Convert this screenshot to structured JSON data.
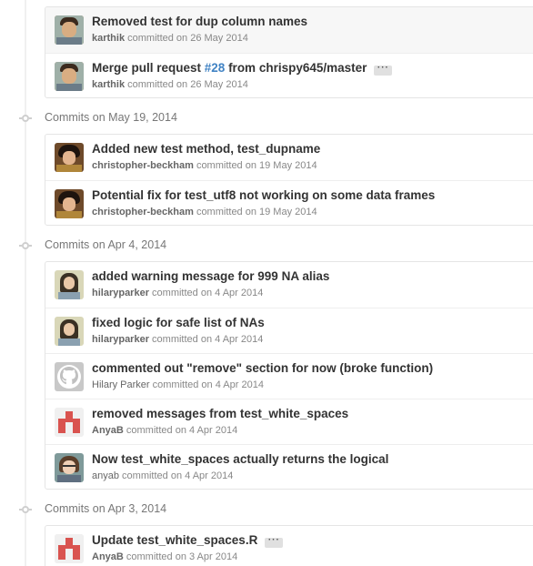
{
  "groups": [
    {
      "title": "",
      "commits": [
        {
          "title": "Removed test for dup column names",
          "author": "karthik",
          "meta": "committed on 26 May 2014",
          "avatar": "karthik-avatar"
        },
        {
          "title_prefix": "Merge pull request ",
          "pr_link": "#28",
          "title_suffix": " from chrispy645/master",
          "ellipsis": "···",
          "author": "karthik",
          "meta": "committed on 26 May 2014",
          "avatar": "karthik-avatar"
        }
      ]
    },
    {
      "title": "Commits on May 19, 2014",
      "commits": [
        {
          "title": "Added new test method, test_dupname",
          "author": "christopher-beckham",
          "meta": "committed on 19 May 2014",
          "avatar": "christopher-avatar"
        },
        {
          "title": "Potential fix for test_utf8 not working on some data frames",
          "author": "christopher-beckham",
          "meta": "committed on 19 May 2014",
          "avatar": "christopher-avatar"
        }
      ]
    },
    {
      "title": "Commits on Apr 4, 2014",
      "commits": [
        {
          "title": "added warning message for 999 NA alias",
          "author": "hilaryparker",
          "meta": "committed on 4 Apr 2014",
          "avatar": "hilary-avatar"
        },
        {
          "title": "fixed logic for safe list of NAs",
          "author": "hilaryparker",
          "meta": "committed on 4 Apr 2014",
          "avatar": "hilary-avatar"
        },
        {
          "title": "commented out \"remove\" section for now (broke function)",
          "author": "Hilary Parker",
          "meta": "committed on 4 Apr 2014",
          "avatar": "github-octocat-avatar"
        },
        {
          "title": "removed messages from test_white_spaces",
          "author": "AnyaB",
          "meta": "committed on 4 Apr 2014",
          "avatar": "identicon-avatar"
        },
        {
          "title": "Now test_white_spaces actually returns the logical",
          "author": "anyab",
          "meta": "committed on 4 Apr 2014",
          "avatar": "anya-avatar"
        }
      ]
    },
    {
      "title": "Commits on Apr 3, 2014",
      "commits": [
        {
          "title": "Update test_white_spaces.R",
          "ellipsis": "···",
          "author": "AnyaB",
          "meta": "committed on 3 Apr 2014",
          "avatar": "identicon-avatar"
        }
      ]
    }
  ],
  "colors": {
    "link": "#4183c4",
    "identicon": "#d9534f",
    "meta_text": "#888888",
    "group_title": "#777777"
  }
}
